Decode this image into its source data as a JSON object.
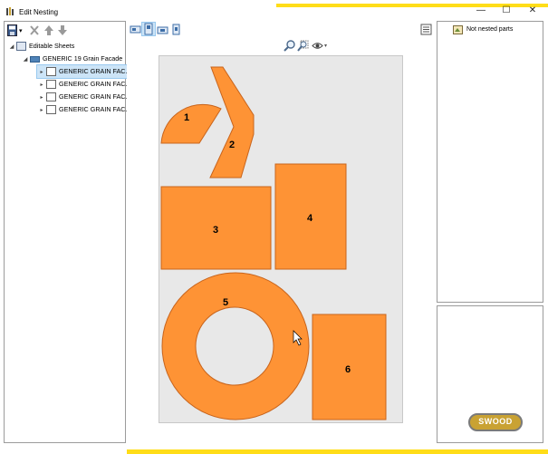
{
  "window": {
    "title": "Edit Nesting",
    "minimize_glyph": "—",
    "maximize_glyph": "☐",
    "close_glyph": "✕"
  },
  "tree": {
    "root_label": "Editable Sheets",
    "group_label": "GENERIC 19 Grain Facade",
    "items": [
      {
        "label": "GENERIC GRAIN FAC..",
        "selected": true
      },
      {
        "label": "GENERIC GRAIN FAC..",
        "selected": false
      },
      {
        "label": "GENERIC GRAIN FAC..",
        "selected": false
      },
      {
        "label": "GENERIC GRAIN FAC..",
        "selected": false
      }
    ]
  },
  "parts_panel": {
    "label": "Not nested parts"
  },
  "nesting": {
    "part_labels": [
      "1",
      "2",
      "3",
      "4",
      "5",
      "6"
    ],
    "part_fill": "#fe9335",
    "part_stroke": "#c8641c",
    "sheet_color": "#e8e8e8"
  },
  "logo": {
    "text": "SWOOD"
  },
  "colors": {
    "accent_yellow": "#ffdd18",
    "selection": "#cce4f7"
  }
}
